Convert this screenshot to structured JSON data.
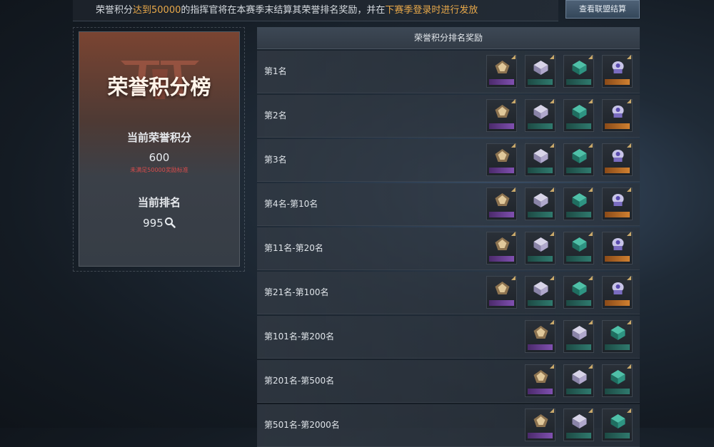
{
  "banner": {
    "part1": "荣誉积分",
    "part2": "达到50000",
    "part3": "的指挥官将在本赛季末结算其荣誉排名奖励，并在",
    "part4": "下赛季登录时进行发放",
    "button_label": "查看联盟结算"
  },
  "left_panel": {
    "title": "荣誉积分榜",
    "points_label": "当前荣誉积分",
    "points_value": "600",
    "points_warning": "未满足50000奖励标准",
    "rank_label": "当前排名",
    "rank_value": "995",
    "icons": [
      "emblem-logo",
      "magnifier-icon"
    ]
  },
  "table": {
    "header": "荣誉积分排名奖励",
    "rows": [
      {
        "label": "第1名",
        "rewards": [
          "gold-crystal",
          "silver-cube",
          "teal-block",
          "purple-helmet"
        ]
      },
      {
        "label": "第2名",
        "rewards": [
          "gold-crystal",
          "silver-cube",
          "teal-block",
          "purple-helmet"
        ]
      },
      {
        "label": "第3名",
        "rewards": [
          "gold-crystal",
          "silver-cube",
          "teal-block",
          "purple-helmet"
        ]
      },
      {
        "label": "第4名-第10名",
        "rewards": [
          "gold-crystal",
          "silver-cube",
          "teal-block",
          "purple-helmet"
        ]
      },
      {
        "label": "第11名-第20名",
        "rewards": [
          "gold-crystal",
          "silver-cube",
          "teal-block",
          "purple-helmet"
        ]
      },
      {
        "label": "第21名-第100名",
        "rewards": [
          "gold-crystal",
          "silver-cube",
          "teal-block",
          "purple-helmet"
        ]
      },
      {
        "label": "第101名-第200名",
        "rewards": [
          "gold-crystal",
          "silver-cube",
          "teal-block"
        ]
      },
      {
        "label": "第201名-第500名",
        "rewards": [
          "gold-crystal",
          "silver-cube",
          "teal-block"
        ]
      },
      {
        "label": "第501名-第2000名",
        "rewards": [
          "gold-crystal",
          "silver-cube",
          "teal-block"
        ]
      }
    ]
  },
  "colors": {
    "highlight": "#e9a94a",
    "warning": "#d94c4c",
    "rarity_purple": "#8050b0",
    "rarity_teal": "#2f7a6e",
    "rarity_orange": "#d08030"
  }
}
